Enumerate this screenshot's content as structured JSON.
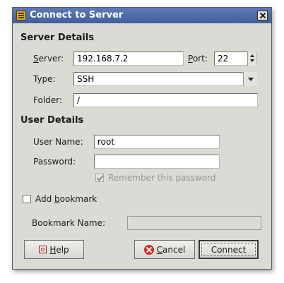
{
  "window": {
    "title": "Connect to Server"
  },
  "server_details": {
    "heading": "Server Details",
    "server_label_accel": "S",
    "server_label_rest": "erver:",
    "server_value": "192.168.7.2",
    "port_label_accel": "P",
    "port_label_rest": "ort:",
    "port_value": "22",
    "type_label": "Type:",
    "type_value": "SSH",
    "folder_label": "Folder:",
    "folder_value": "/"
  },
  "user_details": {
    "heading": "User Details",
    "username_label": "User Name:",
    "username_value": "root",
    "password_label": "Password:",
    "password_value": "",
    "remember_label": "Remember this password",
    "remember_checked": true
  },
  "bookmark": {
    "add_label_pre": "Add ",
    "add_label_accel": "b",
    "add_label_post": "ookmark",
    "add_checked": false,
    "name_label": "Bookmark Name:",
    "name_value": ""
  },
  "buttons": {
    "help_accel": "H",
    "help_rest": "elp",
    "cancel_accel": "C",
    "cancel_rest": "ancel",
    "connect_label": "Connect"
  }
}
